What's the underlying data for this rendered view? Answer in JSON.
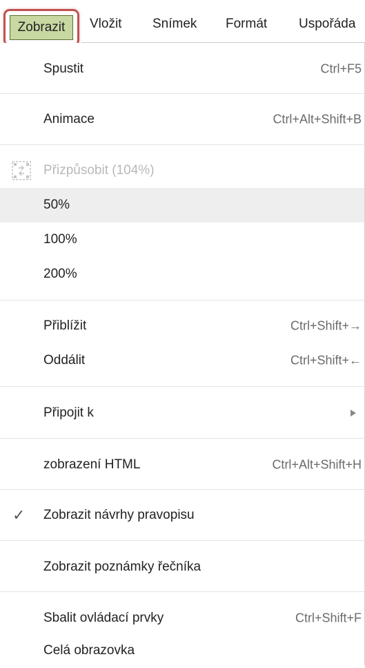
{
  "menubar": {
    "items": [
      {
        "label": "Zobrazit",
        "active": true
      },
      {
        "label": "Vložit"
      },
      {
        "label": "Snímek"
      },
      {
        "label": "Formát"
      },
      {
        "label": "Uspořáda"
      }
    ],
    "colors": {
      "active_bg": "#c7d8a2",
      "highlight_border": "#c0504d"
    }
  },
  "menu": {
    "start": {
      "label": "Spustit",
      "shortcut": "Ctrl+F5"
    },
    "animation": {
      "label": "Animace",
      "shortcut": "Ctrl+Alt+Shift+B"
    },
    "fit": {
      "label": "Přizpůsobit (104%)",
      "disabled": true,
      "icon": "fit-to-window-icon"
    },
    "zoom50": {
      "label": "50%"
    },
    "zoom100": {
      "label": "100%"
    },
    "zoom200": {
      "label": "200%"
    },
    "zoom_in": {
      "label": "Přiblížit",
      "shortcut": "Ctrl+Shift+→"
    },
    "zoom_out": {
      "label": "Oddálit",
      "shortcut": "Ctrl+Shift+←"
    },
    "snap_to": {
      "label": "Připojit k",
      "submenu_icon": "submenu-arrow-icon"
    },
    "html_view": {
      "label": "zobrazení HTML",
      "shortcut": "Ctrl+Alt+Shift+H"
    },
    "spelling": {
      "label": "Zobrazit návrhy pravopisu",
      "checked": true,
      "icon": "checkmark-icon"
    },
    "speaker_notes": {
      "label": "Zobrazit poznámky řečníka"
    },
    "compact": {
      "label": "Sbalit ovládací prvky",
      "shortcut": "Ctrl+Shift+F"
    },
    "fullscreen": {
      "label": "Celá obrazovka"
    }
  }
}
